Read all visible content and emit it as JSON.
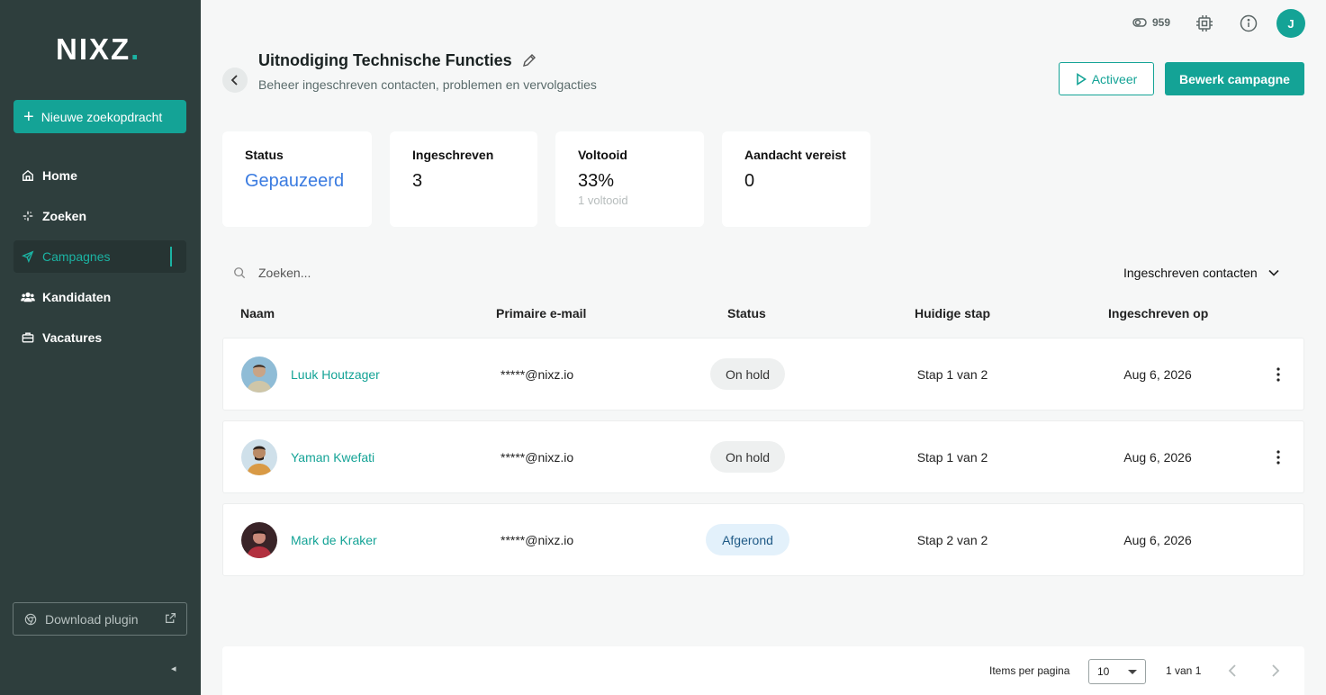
{
  "sidebar": {
    "logo": "NIXZ",
    "logo_dot": ".",
    "new_search_label": "Nieuwe zoekopdracht",
    "items": [
      {
        "label": "Home",
        "icon": "home-icon"
      },
      {
        "label": "Zoeken",
        "icon": "sparkle-icon"
      },
      {
        "label": "Campagnes",
        "icon": "send-icon",
        "active": true
      },
      {
        "label": "Kandidaten",
        "icon": "users-icon"
      },
      {
        "label": "Vacatures",
        "icon": "briefcase-icon"
      }
    ],
    "download_label": "Download plugin",
    "collapse_glyph": "◂"
  },
  "topbar": {
    "credits": "959",
    "avatar_initial": "J"
  },
  "header": {
    "title": "Uitnodiging Technische Functies",
    "subtitle": "Beheer ingeschreven contacten, problemen en vervolgacties",
    "activate_label": "Activeer",
    "edit_label": "Bewerk campagne"
  },
  "stats": [
    {
      "label": "Status",
      "value": "Gepauzeerd"
    },
    {
      "label": "Ingeschreven",
      "value": "3"
    },
    {
      "label": "Voltooid",
      "value": "33%",
      "sub": "1 voltooid"
    },
    {
      "label": "Aandacht vereist",
      "value": "0"
    }
  ],
  "search": {
    "placeholder": "Zoeken..."
  },
  "filter": {
    "label": "Ingeschreven contacten"
  },
  "table": {
    "columns": [
      "Naam",
      "Primaire e-mail",
      "Status",
      "Huidige stap",
      "Ingeschreven op"
    ],
    "rows": [
      {
        "name": "Luuk Houtzager",
        "email": "*****@nixz.io",
        "status": "On hold",
        "step": "Stap 1 van 2",
        "date": "Aug 6, 2026"
      },
      {
        "name": "Yaman Kwefati",
        "email": "*****@nixz.io",
        "status": "On hold",
        "step": "Stap 1 van 2",
        "date": "Aug 6, 2026"
      },
      {
        "name": "Mark de Kraker",
        "email": "*****@nixz.io",
        "status": "Afgerond",
        "step": "Stap 2 van 2",
        "date": "Aug 6, 2026"
      }
    ]
  },
  "pagination": {
    "items_per_page_label": "Items per pagina",
    "items_per_page_value": "10",
    "range": "1 van 1"
  },
  "colors": {
    "accent": "#14a396",
    "sidebar_bg": "#2e3e3d",
    "status_blue": "#3a7be0"
  }
}
